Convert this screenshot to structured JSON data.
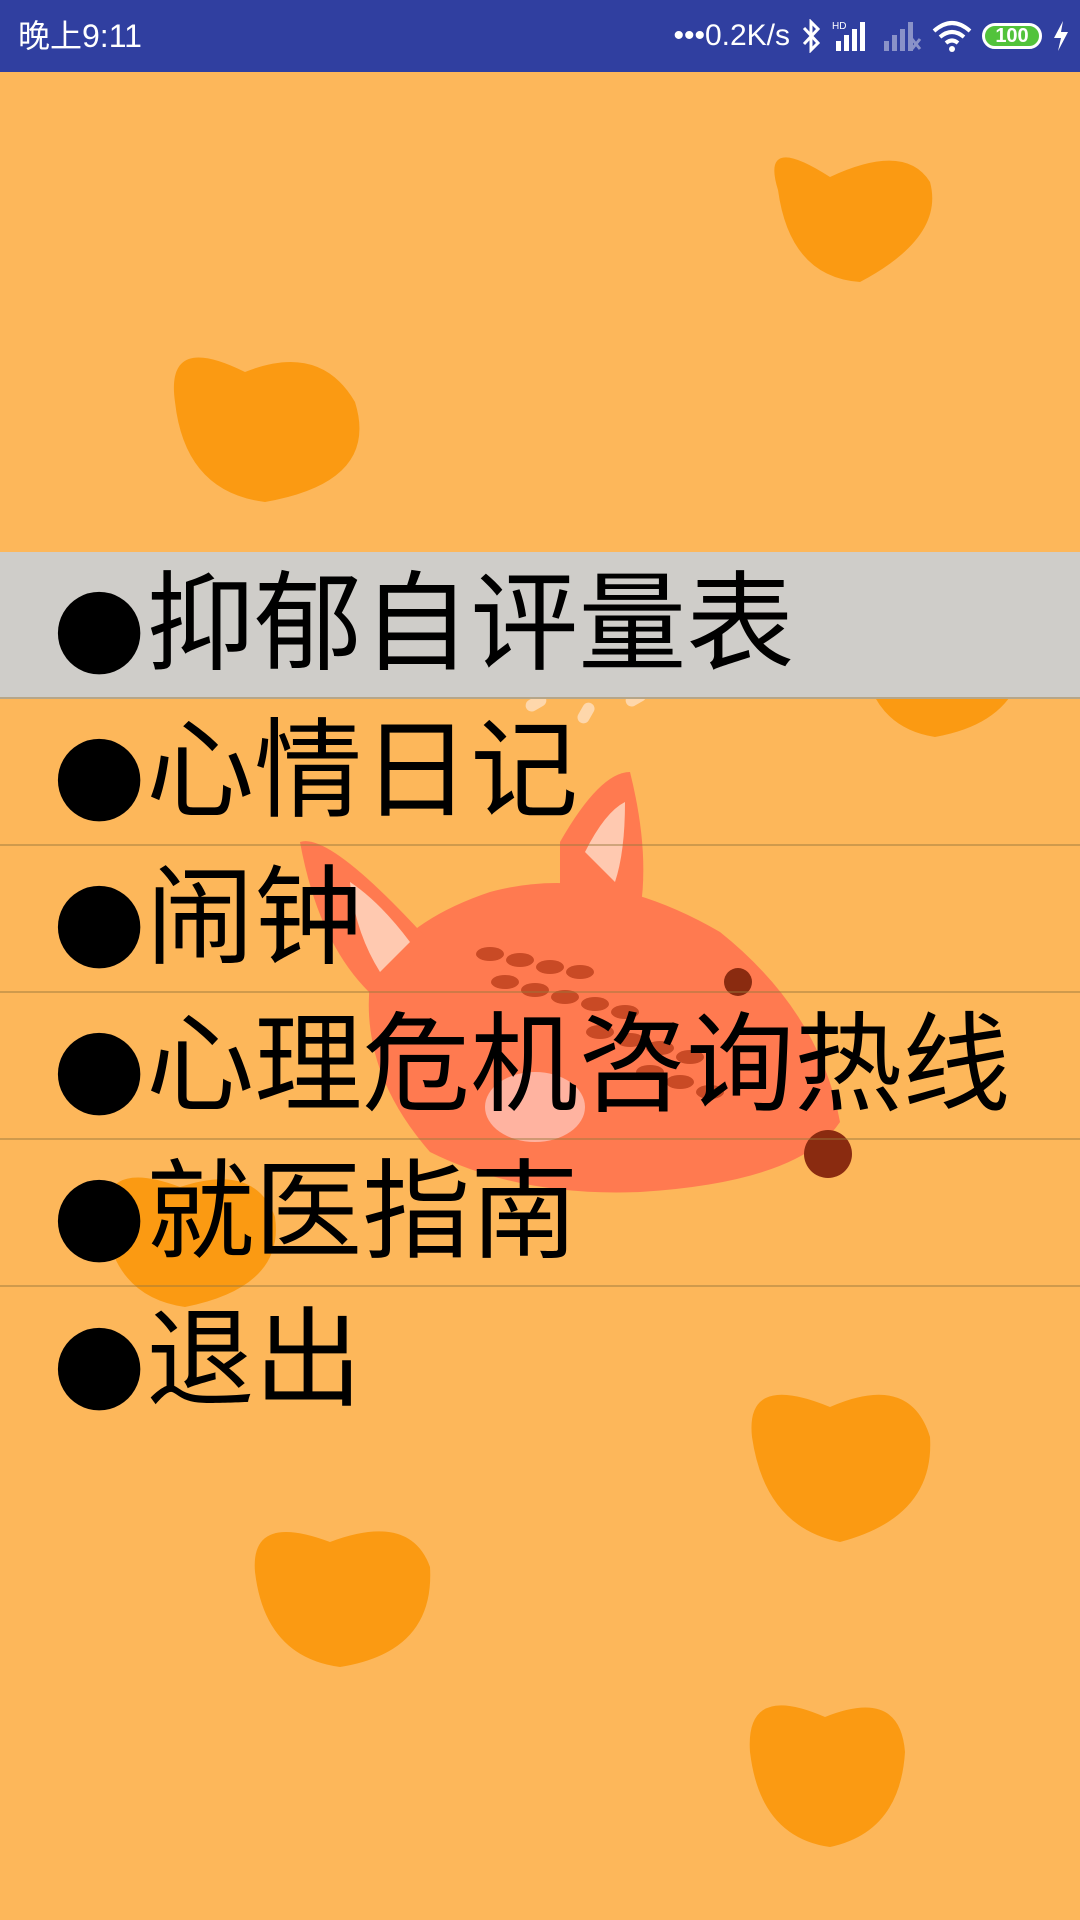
{
  "status_bar": {
    "time": "晚上9:11",
    "net_speed": "•••0.2K/s",
    "battery": "100",
    "icons": [
      "bluetooth-icon",
      "hd-signal-icon",
      "no-signal-icon",
      "wifi-icon",
      "battery-icon",
      "charging-icon"
    ]
  },
  "menu": {
    "items": [
      {
        "label": "●抑郁自评量表",
        "selected": true
      },
      {
        "label": "●心情日记"
      },
      {
        "label": "●闹钟"
      },
      {
        "label": "●心理危机咨询热线"
      },
      {
        "label": "●就医指南"
      },
      {
        "label": "●退出"
      }
    ]
  },
  "colors": {
    "status_bar": "#303fa0",
    "background": "#fdb75a",
    "heart": "#fb9a12",
    "selected_row": "#cfcdc9",
    "fish": "#ff7a50"
  }
}
